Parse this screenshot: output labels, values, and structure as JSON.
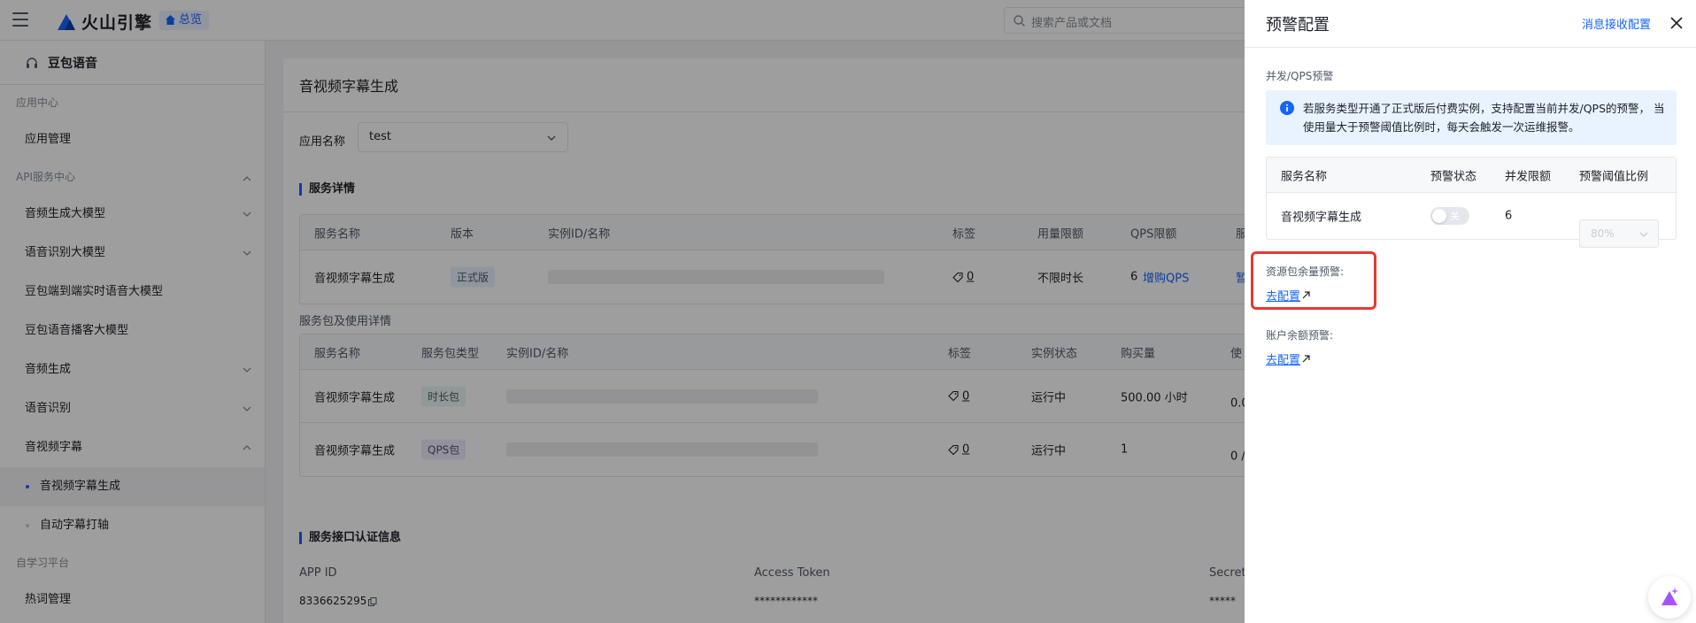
{
  "topbar": {
    "brand": "火山引擎",
    "overview": "总览",
    "search_placeholder": "搜索产品或文档"
  },
  "sidebar": {
    "product": "豆包语音",
    "groups": [
      {
        "label": "应用中心"
      },
      {
        "label": "API服务中心"
      },
      {
        "label": "自学习平台"
      }
    ],
    "items": {
      "app_manage": "应用管理",
      "voice_gen_model": "音频生成大模型",
      "asr_model": "语音识别大模型",
      "e2e_realtime": "豆包端到端实时语音大模型",
      "podcast_model": "豆包语音播客大模型",
      "voice_gen": "音频生成",
      "asr": "语音识别",
      "subtitle": "音视频字幕",
      "subtitle_gen": "音视频字幕生成",
      "auto_subtitle": "自动字幕打轴",
      "hotword": "热词管理"
    }
  },
  "main": {
    "title": "音视频字幕生成",
    "app_label": "应用名称",
    "app_value": "test",
    "service_detail_title": "服务详情",
    "service_table": {
      "headers": [
        "服务名称",
        "版本",
        "实例ID/名称",
        "标签",
        "用量限额",
        "QPS限额",
        "服"
      ],
      "row": {
        "name": "音视频字幕生成",
        "version": "正式版",
        "tags": "0",
        "quota": "不限时长",
        "qps": "6",
        "buy_qps": "增购QPS",
        "extra": "暂"
      }
    },
    "package_title": "服务包及使用详情",
    "package_table": {
      "headers": [
        "服务名称",
        "服务包类型",
        "实例ID/名称",
        "标签",
        "实例状态",
        "购买量",
        "使"
      ],
      "rows": [
        {
          "name": "音视频字幕生成",
          "type": "时长包",
          "tags": "0",
          "status": "运行中",
          "amount": "500.00 小时",
          "usage": "0.0"
        },
        {
          "name": "音视频字幕生成",
          "type": "QPS包",
          "tags": "0",
          "status": "运行中",
          "amount": "1",
          "usage": "0 /"
        }
      ]
    },
    "auth_title": "服务接口认证信息",
    "auth": {
      "app_id_label": "APP ID",
      "app_id_value": "8336625295",
      "token_label": "Access Token",
      "token_value": "************",
      "secret_label": "Secret",
      "secret_value": "*****"
    }
  },
  "drawer": {
    "title": "预警配置",
    "msg_config": "消息接收配置",
    "qps_section": "并发/QPS预警",
    "info_text": "若服务类型开通了正式版后付费实例，支持配置当前并发/QPS的预警， 当使用量大于预警阈值比例时，每天会触发一次运维报警。",
    "table": {
      "headers": [
        "服务名称",
        "预警状态",
        "并发限额",
        "预警阈值比例"
      ],
      "row": {
        "name": "音视频字幕生成",
        "toggle": "关",
        "limit": "6",
        "ratio": "80%"
      }
    },
    "resource_label": "资源包余量预警:",
    "resource_link": "去配置",
    "account_label": "账户余额预警:",
    "account_link": "去配置"
  },
  "colors": {
    "accent": "#1664ff",
    "highlight": "#e53935"
  }
}
